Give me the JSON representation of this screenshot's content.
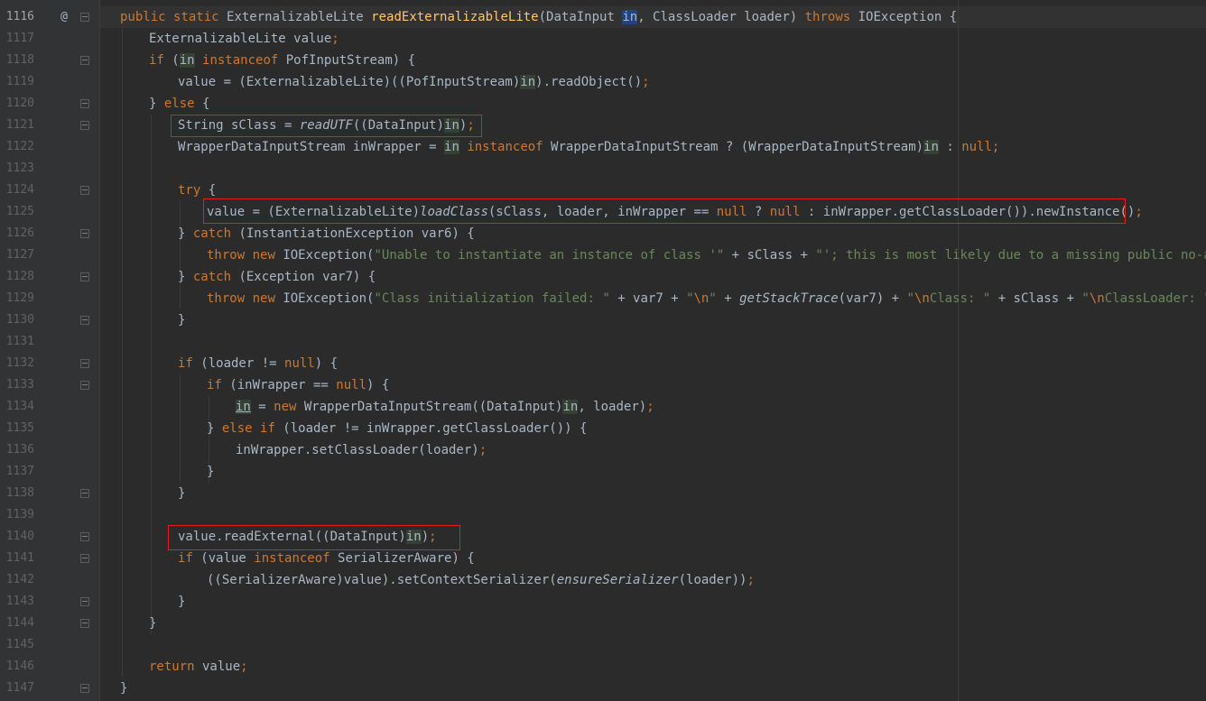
{
  "editor": {
    "current_line": "1116",
    "lines": [
      {
        "n": "1116",
        "text": "public static ExternalizableLite readExternalizableLite(DataInput in, ClassLoader loader) throws IOException {"
      },
      {
        "n": "1117",
        "text": "ExternalizableLite value;"
      },
      {
        "n": "1118",
        "text": "if (in instanceof PofInputStream) {"
      },
      {
        "n": "1119",
        "text": "value = (ExternalizableLite)((PofInputStream)in).readObject();"
      },
      {
        "n": "1120",
        "text": "} else {"
      },
      {
        "n": "1121",
        "text": "String sClass = readUTF((DataInput)in);"
      },
      {
        "n": "1122",
        "text": "WrapperDataInputStream inWrapper = in instanceof WrapperDataInputStream ? (WrapperDataInputStream)in : null;"
      },
      {
        "n": "1123",
        "text": ""
      },
      {
        "n": "1124",
        "text": "try {"
      },
      {
        "n": "1125",
        "text": "value = (ExternalizableLite)loadClass(sClass, loader, inWrapper == null ? null : inWrapper.getClassLoader()).newInstance();"
      },
      {
        "n": "1126",
        "text": "} catch (InstantiationException var6) {"
      },
      {
        "n": "1127",
        "text": "throw new IOException(\"Unable to instantiate an instance of class '\" + sClass + \"'; this is most likely due to a missing public no-args con"
      },
      {
        "n": "1128",
        "text": "} catch (Exception var7) {"
      },
      {
        "n": "1129",
        "text": "throw new IOException(\"Class initialization failed: \" + var7 + \"\\n\" + getStackTrace(var7) + \"\\nClass: \" + sClass + \"\\nClassLoader: \" + load"
      },
      {
        "n": "1130",
        "text": "}"
      },
      {
        "n": "1131",
        "text": ""
      },
      {
        "n": "1132",
        "text": "if (loader != null) {"
      },
      {
        "n": "1133",
        "text": "if (inWrapper == null) {"
      },
      {
        "n": "1134",
        "text": "in = new WrapperDataInputStream((DataInput)in, loader);"
      },
      {
        "n": "1135",
        "text": "} else if (loader != inWrapper.getClassLoader()) {"
      },
      {
        "n": "1136",
        "text": "inWrapper.setClassLoader(loader);"
      },
      {
        "n": "1137",
        "text": "}"
      },
      {
        "n": "1138",
        "text": "}"
      },
      {
        "n": "1139",
        "text": ""
      },
      {
        "n": "1140",
        "text": "value.readExternal((DataInput)in);"
      },
      {
        "n": "1141",
        "text": "if (value instanceof SerializerAware) {"
      },
      {
        "n": "1142",
        "text": "((SerializerAware)value).setContextSerializer(ensureSerializer(loader));"
      },
      {
        "n": "1143",
        "text": "}"
      },
      {
        "n": "1144",
        "text": "}"
      },
      {
        "n": "1145",
        "text": ""
      },
      {
        "n": "1146",
        "text": "return value;"
      },
      {
        "n": "1147",
        "text": "}"
      }
    ],
    "gutter_icon": "@",
    "colors": {
      "background": "#2b2b2b",
      "keyword": "#cc7832",
      "method_decl": "#ffc66d",
      "string": "#6a8759",
      "text": "#a9b7c6",
      "highlight_box": "#e02020"
    }
  }
}
